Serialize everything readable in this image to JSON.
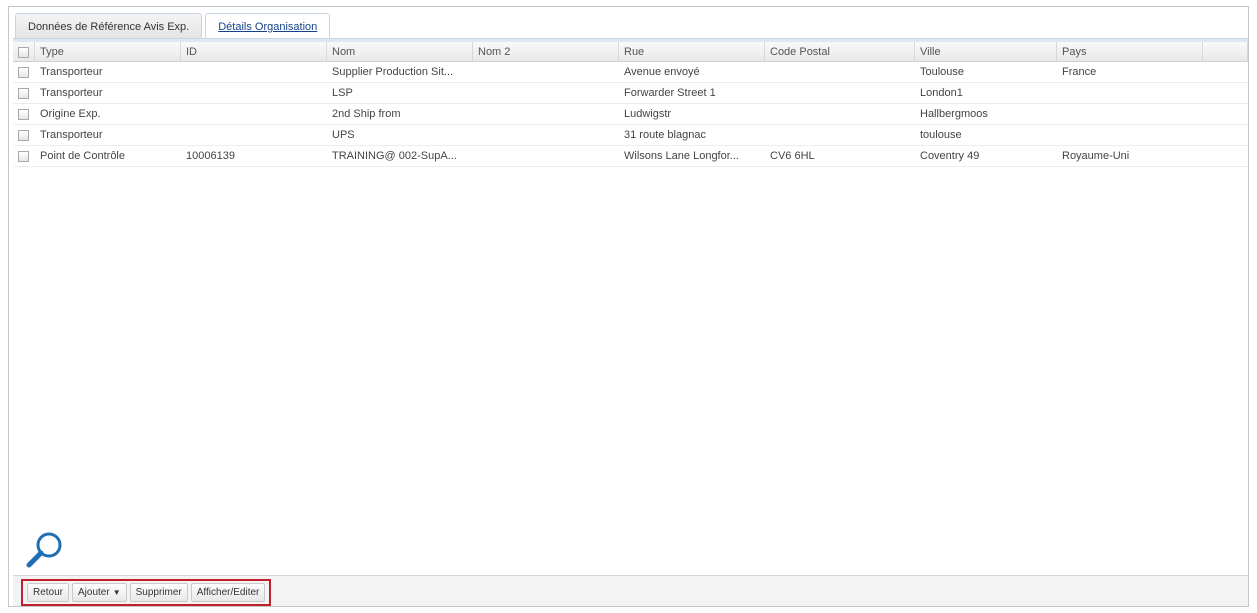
{
  "tabs": [
    {
      "label": "Données de Référence Avis Exp.",
      "active": true
    },
    {
      "label": "Détails Organisation",
      "active": false
    }
  ],
  "table": {
    "columns": [
      "Type",
      "ID",
      "Nom",
      "Nom 2",
      "Rue",
      "Code Postal",
      "Ville",
      "Pays"
    ],
    "rows": [
      {
        "type": "Transporteur",
        "id": "",
        "nom": "Supplier Production Sit...",
        "nom2": "",
        "rue": "Avenue envoyé",
        "cp": "",
        "ville": "Toulouse",
        "pays": "France"
      },
      {
        "type": "Transporteur",
        "id": "",
        "nom": "LSP",
        "nom2": "",
        "rue": "Forwarder Street 1",
        "cp": "",
        "ville": "London1",
        "pays": ""
      },
      {
        "type": "Origine Exp.",
        "id": "",
        "nom": "2nd Ship from",
        "nom2": "",
        "rue": "Ludwigstr",
        "cp": "",
        "ville": "Hallbergmoos",
        "pays": ""
      },
      {
        "type": "Transporteur",
        "id": "",
        "nom": "UPS",
        "nom2": "",
        "rue": "31 route blagnac",
        "cp": "",
        "ville": "toulouse",
        "pays": ""
      },
      {
        "type": "Point de Contrôle",
        "id": "10006139",
        "nom": "TRAINING@ 002-SupA...",
        "nom2": "",
        "rue": "Wilsons Lane Longfor...",
        "cp": "CV6 6HL",
        "ville": "Coventry 49",
        "pays": "Royaume-Uni"
      }
    ]
  },
  "toolbar": {
    "retour": "Retour",
    "ajouter": "Ajouter",
    "supprimer": "Supprimer",
    "afficher": "Afficher/Editer"
  },
  "colors": {
    "highlight_border": "#c0202c",
    "tab_link": "#15428b",
    "search_icon": "#1f6fb5"
  },
  "icons": [
    "search-icon",
    "caret-down-icon",
    "checkbox"
  ]
}
